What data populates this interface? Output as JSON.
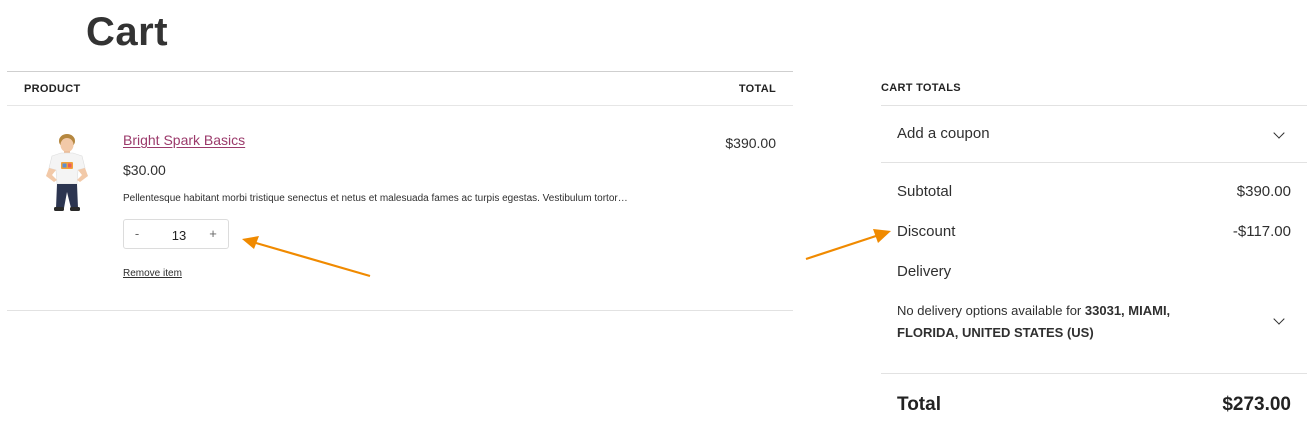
{
  "page": {
    "title": "Cart"
  },
  "cart_table": {
    "headers": {
      "product": "PRODUCT",
      "total": "TOTAL"
    },
    "item": {
      "image_icon": "kid-tshirt-product-photo",
      "name": "Bright Spark Basics",
      "unit_price": "$30.00",
      "description": "Pellentesque habitant morbi tristique senectus et netus et malesuada fames ac turpis egestas. Vestibulum tortor…",
      "quantity": "13",
      "minus_label": "-",
      "plus_label": "+",
      "remove_label": "Remove item",
      "line_total": "$390.00"
    }
  },
  "totals": {
    "heading": "CART TOTALS",
    "coupon_label": "Add a coupon",
    "subtotal_label": "Subtotal",
    "subtotal_value": "$390.00",
    "discount_label": "Discount",
    "discount_value": "-$117.00",
    "delivery_label": "Delivery",
    "delivery_note_prefix": "No delivery options available for",
    "delivery_location": "33031, MIAMI, FLORIDA, UNITED STATES (US)",
    "total_label": "Total",
    "total_value": "$273.00"
  },
  "colors": {
    "link": "#9b3a6b",
    "annotation_arrow": "#f08a00",
    "divider": "#e2e2e2"
  }
}
